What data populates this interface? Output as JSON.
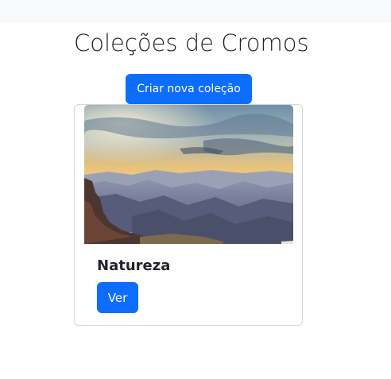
{
  "page": {
    "title": "Coleções de Cromos",
    "create_button_label": "Criar nova coleção"
  },
  "collections": [
    {
      "name": "Natureza",
      "view_button_label": "Ver",
      "image_description": "landscape-photo"
    }
  ],
  "colors": {
    "primary": "#0d6efd",
    "topbar": "#f8f9fa",
    "card_border": "#d5d7da",
    "text": "#212529"
  }
}
